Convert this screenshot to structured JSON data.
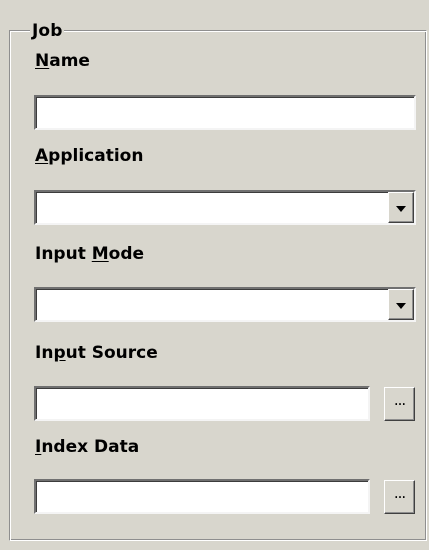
{
  "group": {
    "title": "Job"
  },
  "fields": {
    "name": {
      "label_before": "",
      "label_underline": "N",
      "label_after": "ame",
      "value": ""
    },
    "application": {
      "label_before": "",
      "label_underline": "A",
      "label_after": "pplication",
      "value": ""
    },
    "input_mode": {
      "label_before": "Input ",
      "label_underline": "M",
      "label_after": "ode",
      "value": ""
    },
    "input_source": {
      "label_before": "In",
      "label_underline": "p",
      "label_after": "ut Source",
      "value": "",
      "browse_label": "..."
    },
    "index_data": {
      "label_before": "",
      "label_underline": "I",
      "label_after": "ndex Data",
      "value": "",
      "browse_label": "..."
    }
  },
  "icons": {
    "combo_dropdown": "chevron-down-icon"
  }
}
